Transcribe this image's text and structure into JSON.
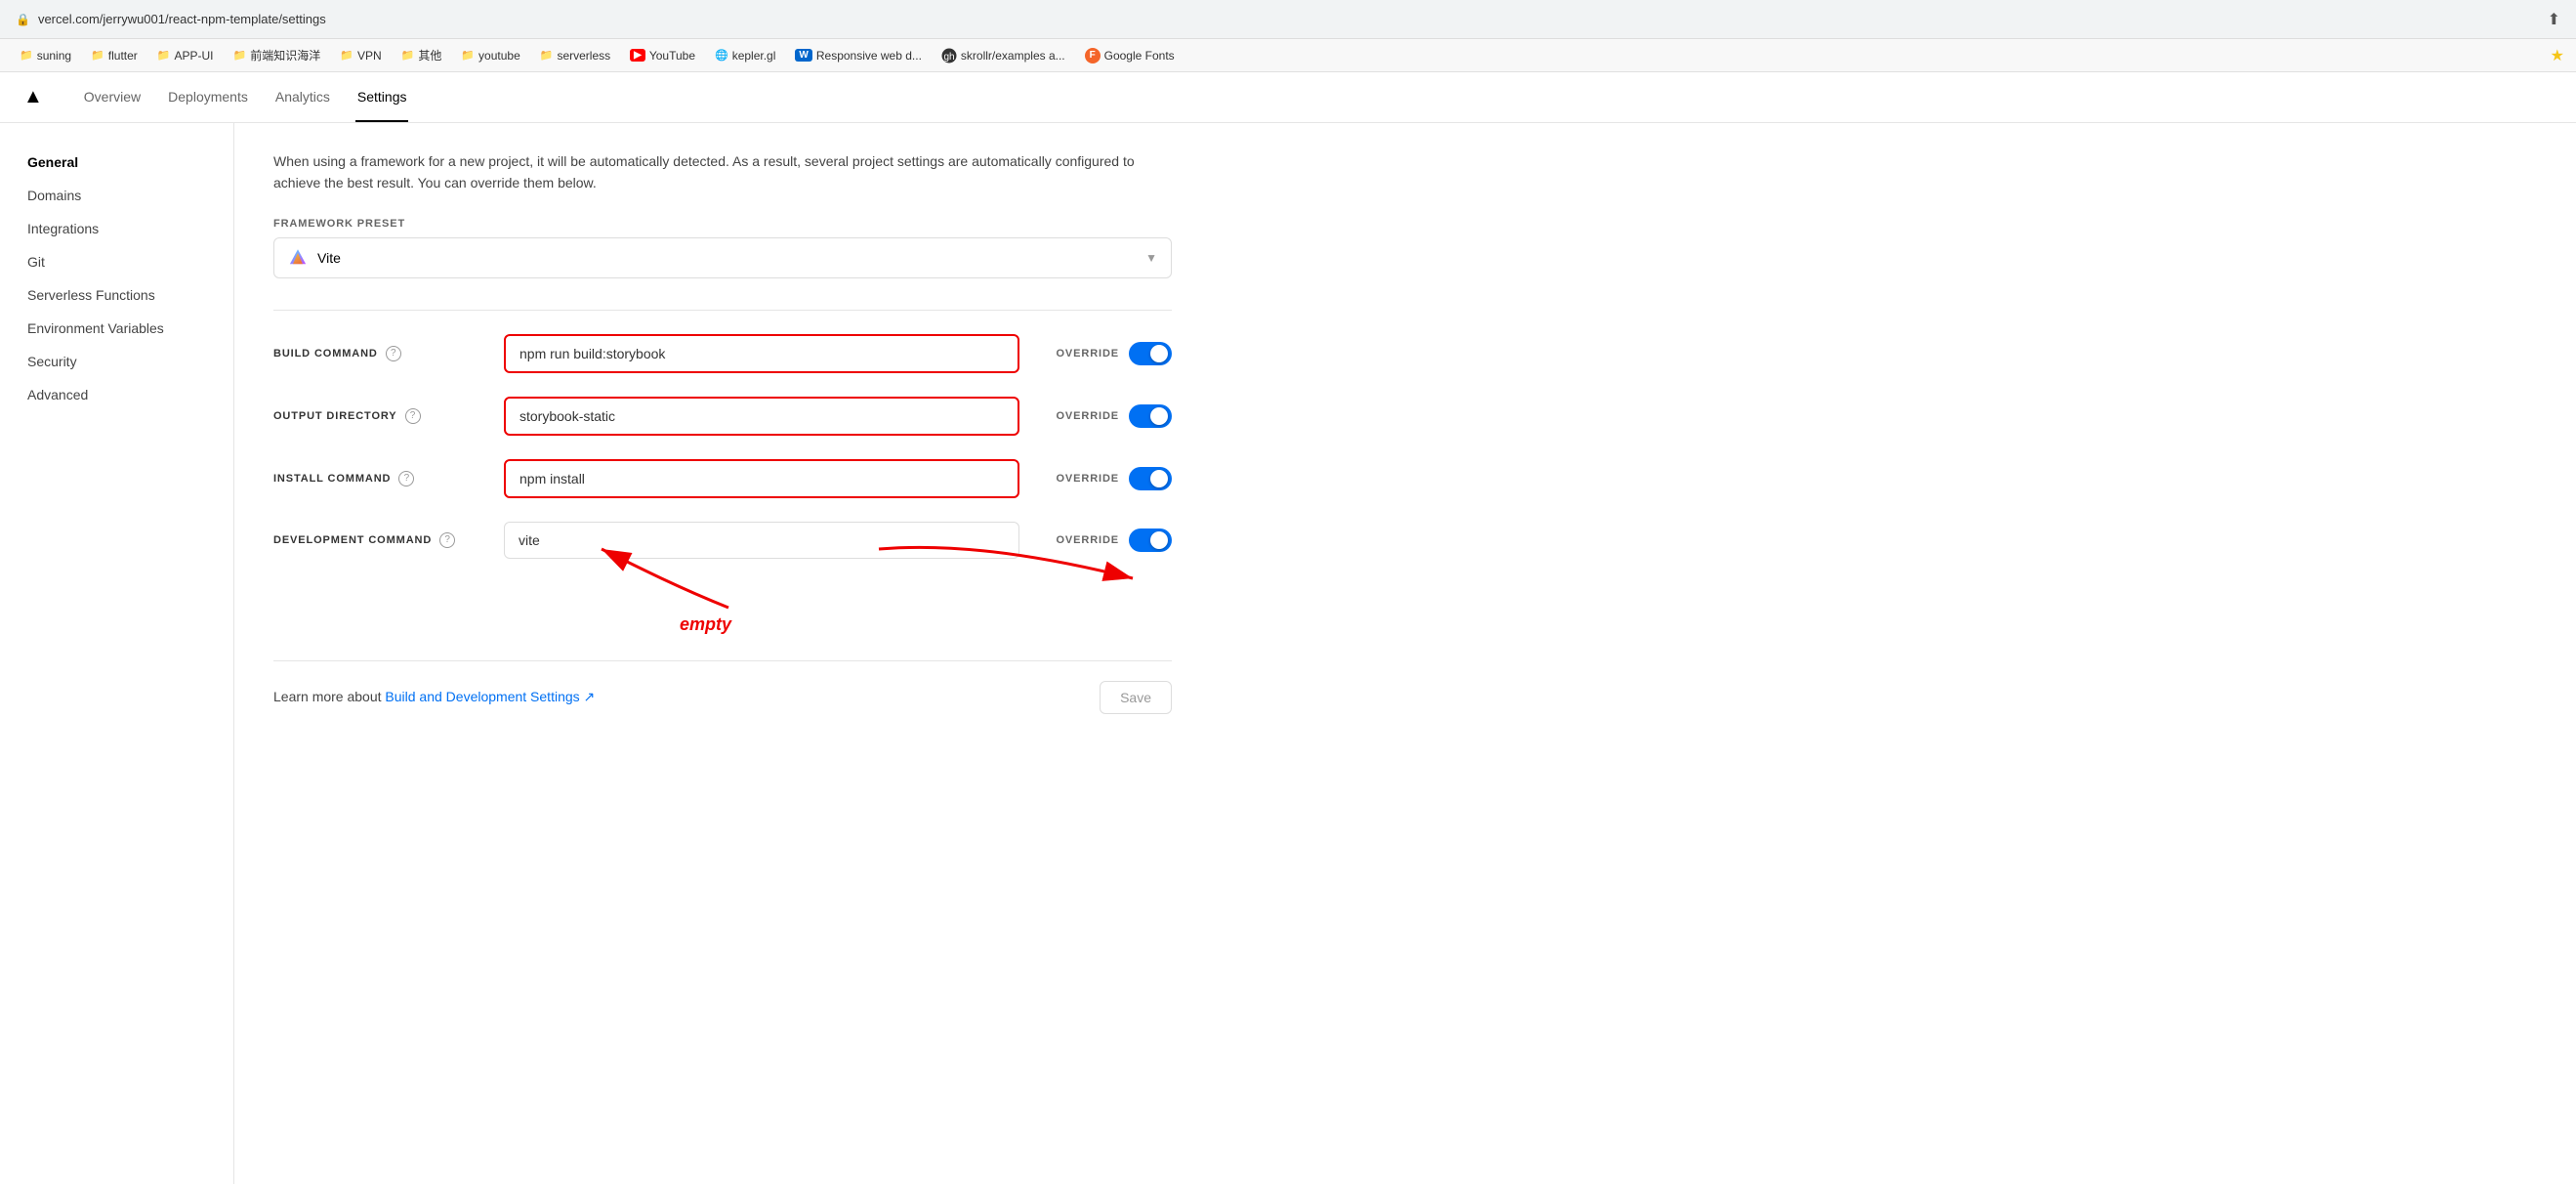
{
  "browser": {
    "url": "vercel.com/jerrywu001/react-npm-template/settings",
    "bookmarks": [
      {
        "label": "suning",
        "type": "folder"
      },
      {
        "label": "flutter",
        "type": "folder"
      },
      {
        "label": "APP-UI",
        "type": "folder"
      },
      {
        "label": "前端知识海洋",
        "type": "folder"
      },
      {
        "label": "VPN",
        "type": "folder"
      },
      {
        "label": "其他",
        "type": "folder"
      },
      {
        "label": "youtube",
        "type": "folder"
      },
      {
        "label": "serverless",
        "type": "folder"
      },
      {
        "label": "YouTube",
        "type": "yt"
      },
      {
        "label": "kepler.gl",
        "type": "kepler"
      },
      {
        "label": "Responsive web d...",
        "type": "w"
      },
      {
        "label": "skrollr/examples a...",
        "type": "gh"
      },
      {
        "label": "Google Fonts",
        "type": "f"
      }
    ]
  },
  "header": {
    "nav_items": [
      {
        "label": "Overview",
        "active": false
      },
      {
        "label": "Deployments",
        "active": false
      },
      {
        "label": "Analytics",
        "active": false
      },
      {
        "label": "Settings",
        "active": true
      }
    ]
  },
  "sidebar": {
    "items": [
      {
        "label": "General",
        "active": true
      },
      {
        "label": "Domains",
        "active": false
      },
      {
        "label": "Integrations",
        "active": false
      },
      {
        "label": "Git",
        "active": false
      },
      {
        "label": "Serverless Functions",
        "active": false
      },
      {
        "label": "Environment Variables",
        "active": false
      },
      {
        "label": "Security",
        "active": false
      },
      {
        "label": "Advanced",
        "active": false
      }
    ]
  },
  "content": {
    "description": "When using a framework for a new project, it will be automatically detected. As a result, several project settings are automatically configured to achieve the best result. You can override them below.",
    "framework_preset_label": "FRAMEWORK PRESET",
    "framework_value": "Vite",
    "build_settings": [
      {
        "label": "BUILD COMMAND",
        "value": "npm run build:storybook",
        "placeholder": "",
        "highlighted": true,
        "override_enabled": true
      },
      {
        "label": "OUTPUT DIRECTORY",
        "value": "storybook-static",
        "placeholder": "",
        "highlighted": true,
        "override_enabled": true
      },
      {
        "label": "INSTALL COMMAND",
        "value": "npm install",
        "placeholder": "",
        "highlighted": true,
        "override_enabled": true
      },
      {
        "label": "DEVELOPMENT COMMAND",
        "value": "vite",
        "placeholder": "vite",
        "highlighted": false,
        "override_enabled": true
      }
    ],
    "override_label": "OVERRIDE",
    "footer": {
      "text": "Learn more about ",
      "link_text": "Build and Development Settings",
      "save_label": "Save"
    },
    "annotation": {
      "empty_label": "empty"
    }
  }
}
